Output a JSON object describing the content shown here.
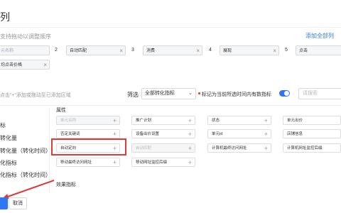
{
  "header": {
    "title": "列"
  },
  "order": {
    "hint": "支持拖动以调整顺序",
    "add_all": "添加全部列",
    "chips": [
      {
        "label": "元名称",
        "faded": true,
        "close": ""
      },
      {
        "num": "2",
        "label": "自动匹配",
        "close": "×"
      },
      {
        "num": "3",
        "label": "消费",
        "close": "×"
      },
      {
        "num": "4",
        "label": "展现",
        "close": "×"
      },
      {
        "num": "5",
        "label": "点击",
        "close": ""
      },
      {
        "label": "均点击价格",
        "close": "×"
      }
    ]
  },
  "toolbar": {
    "hint": "点击“+”添加或拖动至已添加区域",
    "filter_label": "筛选",
    "filter_value": "全部转化指标",
    "flag_label": "标记为当前所选时间内有数指标",
    "search_placeholder": "请搜索"
  },
  "categories": [
    "标",
    "转化量",
    "转化量（转化时间）",
    "化指标",
    "化指标（转化时间）"
  ],
  "attributes": {
    "title": "属性",
    "items": [
      {
        "label": "单元名称",
        "disabled": true
      },
      {
        "label": "推广计划",
        "disabled": false
      },
      {
        "label": "状态",
        "disabled": false
      },
      {
        "label": "单元出价",
        "disabled": false
      },
      {
        "label": "否定关键词",
        "disabled": false
      },
      {
        "label": "设备出价设置",
        "disabled": false
      },
      {
        "label": "单元id",
        "disabled": false
      },
      {
        "label": "店铺信息",
        "disabled": false
      },
      {
        "label": "自动定向",
        "disabled": false
      },
      {
        "label": "自动匹配",
        "disabled": true
      },
      {
        "label": "计算机最终访问网址",
        "disabled": false
      },
      {
        "label": "计算机网址监控后缀",
        "disabled": false
      },
      {
        "label": "移动最终访问网址",
        "disabled": false
      },
      {
        "label": "移动网址监控后缀",
        "disabled": false
      }
    ]
  },
  "effect": {
    "title": "效果指标"
  },
  "footer": {
    "cancel_label": "取消"
  },
  "colors": {
    "accent": "#2f76f6",
    "highlight": "#e03a3a"
  }
}
